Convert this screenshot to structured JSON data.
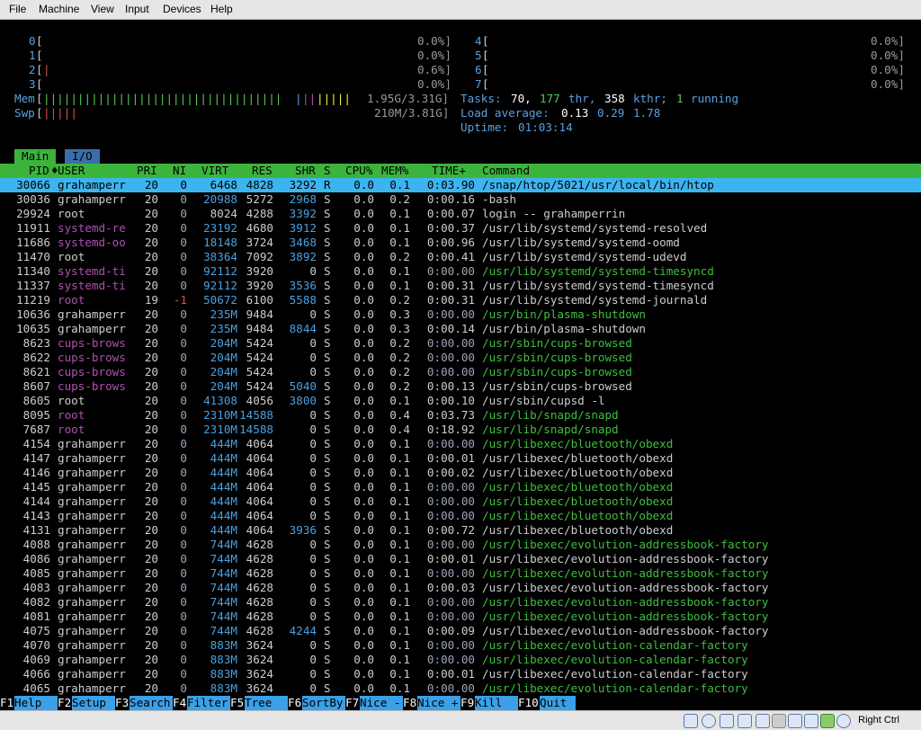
{
  "menubar": [
    "File",
    "Machine",
    "View",
    "Input",
    "Devices",
    "Help"
  ],
  "cpus": [
    {
      "id": "0",
      "val": "0.0%]"
    },
    {
      "id": "1",
      "val": "0.0%]"
    },
    {
      "id": "2",
      "val": "0.6%]"
    },
    {
      "id": "3",
      "val": "0.0%]"
    },
    {
      "id": "4",
      "val": "0.0%]"
    },
    {
      "id": "5",
      "val": "0.0%]"
    },
    {
      "id": "6",
      "val": "0.0%]"
    },
    {
      "id": "7",
      "val": "0.0%]"
    }
  ],
  "mem": {
    "label": "Mem",
    "value": "1.95G/3.31G]"
  },
  "swp": {
    "label": "Swp",
    "value": "210M/3.81G]"
  },
  "tasks": {
    "label": "Tasks:",
    "procs": "70,",
    "thr": "177",
    "thr_label": "thr,",
    "kthr": "358",
    "kthr_label": "kthr;",
    "running": "1",
    "running_label": "running"
  },
  "load": {
    "label": "Load average:",
    "v1": "0.13",
    "v2": "0.29",
    "v3": "1.78"
  },
  "uptime": {
    "label": "Uptime:",
    "value": "01:03:14"
  },
  "tabs": [
    "Main",
    "I/O"
  ],
  "columns": [
    "PID",
    "USER",
    "PRI",
    "NI",
    "VIRT",
    "RES",
    "SHR",
    "S",
    "CPU%",
    "MEM%",
    "TIME+",
    "Command"
  ],
  "rows": [
    [
      "30066",
      "grahamperr",
      "20",
      "0",
      "6468",
      "4828",
      "3292",
      "R",
      "0.0",
      "0.1",
      "0:03.90",
      "/snap/htop/5021/usr/local/bin/htop"
    ],
    [
      "30036",
      "grahamperr",
      "20",
      "0",
      "20988",
      "5272",
      "2968",
      "S",
      "0.0",
      "0.2",
      "0:00.16",
      "-bash"
    ],
    [
      "29924",
      "root",
      "20",
      "0",
      "8024",
      "4288",
      "3392",
      "S",
      "0.0",
      "0.1",
      "0:00.07",
      "login -- grahamperrin"
    ],
    [
      "11911",
      "systemd-re",
      "20",
      "0",
      "23192",
      "4680",
      "3912",
      "S",
      "0.0",
      "0.1",
      "0:00.37",
      "/usr/lib/systemd/systemd-resolved"
    ],
    [
      "11686",
      "systemd-oo",
      "20",
      "0",
      "18148",
      "3724",
      "3468",
      "S",
      "0.0",
      "0.1",
      "0:00.96",
      "/usr/lib/systemd/systemd-oomd"
    ],
    [
      "11470",
      "root",
      "20",
      "0",
      "38364",
      "7092",
      "3892",
      "S",
      "0.0",
      "0.2",
      "0:00.41",
      "/usr/lib/systemd/systemd-udevd"
    ],
    [
      "11340",
      "systemd-ti",
      "20",
      "0",
      "92112",
      "3920",
      "0",
      "S",
      "0.0",
      "0.1",
      "0:00.00",
      "/usr/lib/systemd/systemd-timesyncd"
    ],
    [
      "11337",
      "systemd-ti",
      "20",
      "0",
      "92112",
      "3920",
      "3536",
      "S",
      "0.0",
      "0.1",
      "0:00.31",
      "/usr/lib/systemd/systemd-timesyncd"
    ],
    [
      "11219",
      "root",
      "19",
      "-1",
      "50672",
      "6100",
      "5588",
      "S",
      "0.0",
      "0.2",
      "0:00.31",
      "/usr/lib/systemd/systemd-journald"
    ],
    [
      "10636",
      "grahamperr",
      "20",
      "0",
      "235M",
      "9484",
      "0",
      "S",
      "0.0",
      "0.3",
      "0:00.00",
      "/usr/bin/plasma-shutdown"
    ],
    [
      "10635",
      "grahamperr",
      "20",
      "0",
      "235M",
      "9484",
      "8844",
      "S",
      "0.0",
      "0.3",
      "0:00.14",
      "/usr/bin/plasma-shutdown"
    ],
    [
      "8623",
      "cups-brows",
      "20",
      "0",
      "204M",
      "5424",
      "0",
      "S",
      "0.0",
      "0.2",
      "0:00.00",
      "/usr/sbin/cups-browsed"
    ],
    [
      "8622",
      "cups-brows",
      "20",
      "0",
      "204M",
      "5424",
      "0",
      "S",
      "0.0",
      "0.2",
      "0:00.00",
      "/usr/sbin/cups-browsed"
    ],
    [
      "8621",
      "cups-brows",
      "20",
      "0",
      "204M",
      "5424",
      "0",
      "S",
      "0.0",
      "0.2",
      "0:00.00",
      "/usr/sbin/cups-browsed"
    ],
    [
      "8607",
      "cups-brows",
      "20",
      "0",
      "204M",
      "5424",
      "5040",
      "S",
      "0.0",
      "0.2",
      "0:00.13",
      "/usr/sbin/cups-browsed"
    ],
    [
      "8605",
      "root",
      "20",
      "0",
      "41308",
      "4056",
      "3800",
      "S",
      "0.0",
      "0.1",
      "0:00.10",
      "/usr/sbin/cupsd -l"
    ],
    [
      "8095",
      "root",
      "20",
      "0",
      "2310M",
      "14588",
      "0",
      "S",
      "0.0",
      "0.4",
      "0:03.73",
      "/usr/lib/snapd/snapd"
    ],
    [
      "7687",
      "root",
      "20",
      "0",
      "2310M",
      "14588",
      "0",
      "S",
      "0.0",
      "0.4",
      "0:18.92",
      "/usr/lib/snapd/snapd"
    ],
    [
      "4154",
      "grahamperr",
      "20",
      "0",
      "444M",
      "4064",
      "0",
      "S",
      "0.0",
      "0.1",
      "0:00.00",
      "/usr/libexec/bluetooth/obexd"
    ],
    [
      "4147",
      "grahamperr",
      "20",
      "0",
      "444M",
      "4064",
      "0",
      "S",
      "0.0",
      "0.1",
      "0:00.01",
      "/usr/libexec/bluetooth/obexd"
    ],
    [
      "4146",
      "grahamperr",
      "20",
      "0",
      "444M",
      "4064",
      "0",
      "S",
      "0.0",
      "0.1",
      "0:00.02",
      "/usr/libexec/bluetooth/obexd"
    ],
    [
      "4145",
      "grahamperr",
      "20",
      "0",
      "444M",
      "4064",
      "0",
      "S",
      "0.0",
      "0.1",
      "0:00.00",
      "/usr/libexec/bluetooth/obexd"
    ],
    [
      "4144",
      "grahamperr",
      "20",
      "0",
      "444M",
      "4064",
      "0",
      "S",
      "0.0",
      "0.1",
      "0:00.00",
      "/usr/libexec/bluetooth/obexd"
    ],
    [
      "4143",
      "grahamperr",
      "20",
      "0",
      "444M",
      "4064",
      "0",
      "S",
      "0.0",
      "0.1",
      "0:00.00",
      "/usr/libexec/bluetooth/obexd"
    ],
    [
      "4131",
      "grahamperr",
      "20",
      "0",
      "444M",
      "4064",
      "3936",
      "S",
      "0.0",
      "0.1",
      "0:00.72",
      "/usr/libexec/bluetooth/obexd"
    ],
    [
      "4088",
      "grahamperr",
      "20",
      "0",
      "744M",
      "4628",
      "0",
      "S",
      "0.0",
      "0.1",
      "0:00.00",
      "/usr/libexec/evolution-addressbook-factory"
    ],
    [
      "4086",
      "grahamperr",
      "20",
      "0",
      "744M",
      "4628",
      "0",
      "S",
      "0.0",
      "0.1",
      "0:00.01",
      "/usr/libexec/evolution-addressbook-factory"
    ],
    [
      "4085",
      "grahamperr",
      "20",
      "0",
      "744M",
      "4628",
      "0",
      "S",
      "0.0",
      "0.1",
      "0:00.00",
      "/usr/libexec/evolution-addressbook-factory"
    ],
    [
      "4083",
      "grahamperr",
      "20",
      "0",
      "744M",
      "4628",
      "0",
      "S",
      "0.0",
      "0.1",
      "0:00.03",
      "/usr/libexec/evolution-addressbook-factory"
    ],
    [
      "4082",
      "grahamperr",
      "20",
      "0",
      "744M",
      "4628",
      "0",
      "S",
      "0.0",
      "0.1",
      "0:00.00",
      "/usr/libexec/evolution-addressbook-factory"
    ],
    [
      "4081",
      "grahamperr",
      "20",
      "0",
      "744M",
      "4628",
      "0",
      "S",
      "0.0",
      "0.1",
      "0:00.00",
      "/usr/libexec/evolution-addressbook-factory"
    ],
    [
      "4075",
      "grahamperr",
      "20",
      "0",
      "744M",
      "4628",
      "4244",
      "S",
      "0.0",
      "0.1",
      "0:00.09",
      "/usr/libexec/evolution-addressbook-factory"
    ],
    [
      "4070",
      "grahamperr",
      "20",
      "0",
      "883M",
      "3624",
      "0",
      "S",
      "0.0",
      "0.1",
      "0:00.00",
      "/usr/libexec/evolution-calendar-factory"
    ],
    [
      "4069",
      "grahamperr",
      "20",
      "0",
      "883M",
      "3624",
      "0",
      "S",
      "0.0",
      "0.1",
      "0:00.00",
      "/usr/libexec/evolution-calendar-factory"
    ],
    [
      "4066",
      "grahamperr",
      "20",
      "0",
      "883M",
      "3624",
      "0",
      "S",
      "0.0",
      "0.1",
      "0:00.01",
      "/usr/libexec/evolution-calendar-factory"
    ],
    [
      "4065",
      "grahamperr",
      "20",
      "0",
      "883M",
      "3624",
      "0",
      "S",
      "0.0",
      "0.1",
      "0:00.00",
      "/usr/libexec/evolution-calendar-factory"
    ]
  ],
  "fkeys": [
    {
      "key": "F1",
      "label": "Help"
    },
    {
      "key": "F2",
      "label": "Setup"
    },
    {
      "key": "F3",
      "label": "Search"
    },
    {
      "key": "F4",
      "label": "Filter"
    },
    {
      "key": "F5",
      "label": "Tree"
    },
    {
      "key": "F6",
      "label": "SortBy"
    },
    {
      "key": "F7",
      "label": "Nice -"
    },
    {
      "key": "F8",
      "label": "Nice +"
    },
    {
      "key": "F9",
      "label": "Kill"
    },
    {
      "key": "F10",
      "label": "Quit"
    }
  ],
  "statusbar": {
    "host_key": "Right Ctrl"
  },
  "colors": {
    "header_bg": "#3cb43c",
    "selected_bg": "#3cb4f0",
    "fkey_bg": "#3aa0e8"
  }
}
